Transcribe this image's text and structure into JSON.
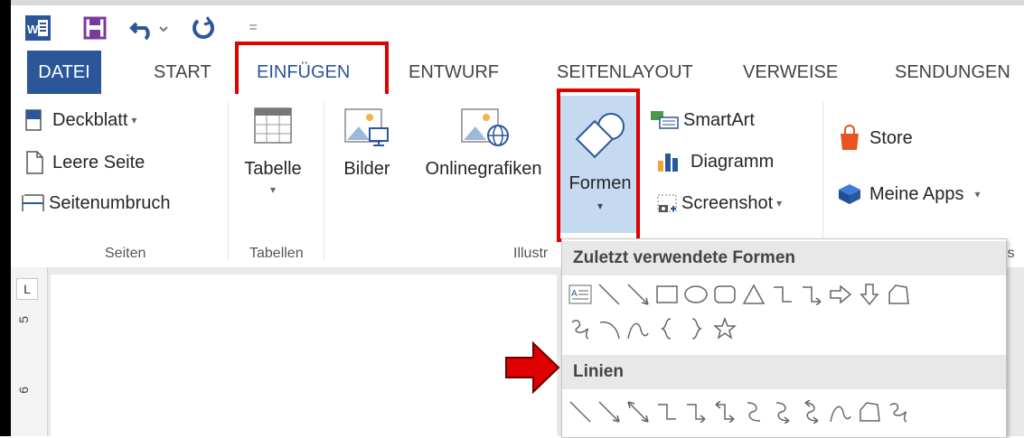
{
  "app": {
    "word_icon_label": "W"
  },
  "qat": {
    "more": "="
  },
  "tabs": [
    {
      "label": "DATEI"
    },
    {
      "label": "START"
    },
    {
      "label": "EINFÜGEN"
    },
    {
      "label": "ENTWURF"
    },
    {
      "label": "SEITENLAYOUT"
    },
    {
      "label": "VERWEISE"
    },
    {
      "label": "SENDUNGEN"
    }
  ],
  "ribbon": {
    "seiten": {
      "deckblatt": "Deckblatt",
      "leere_seite": "Leere Seite",
      "seitenumbruch": "Seitenumbruch",
      "label": "Seiten"
    },
    "tabellen": {
      "tabelle": "Tabelle",
      "label": "Tabellen"
    },
    "illustrationen": {
      "bilder": "Bilder",
      "onlinegrafiken": "Onlinegrafiken",
      "formen": "Formen",
      "smartart": "SmartArt",
      "diagramm": "Diagramm",
      "screenshot": "Screenshot",
      "label": "Illustr"
    },
    "apps": {
      "store": "Store",
      "meine_apps": "Meine Apps",
      "label_partial": "ıs"
    }
  },
  "ruler": {
    "corner": "L",
    "n1": "5",
    "n2": "6"
  },
  "dropdown": {
    "recent_header": "Zuletzt verwendete Formen",
    "lines_header": "Linien"
  },
  "colors": {
    "accent": "#2b579a",
    "highlight": "#e00000",
    "formen_bg": "#c5daf0"
  }
}
